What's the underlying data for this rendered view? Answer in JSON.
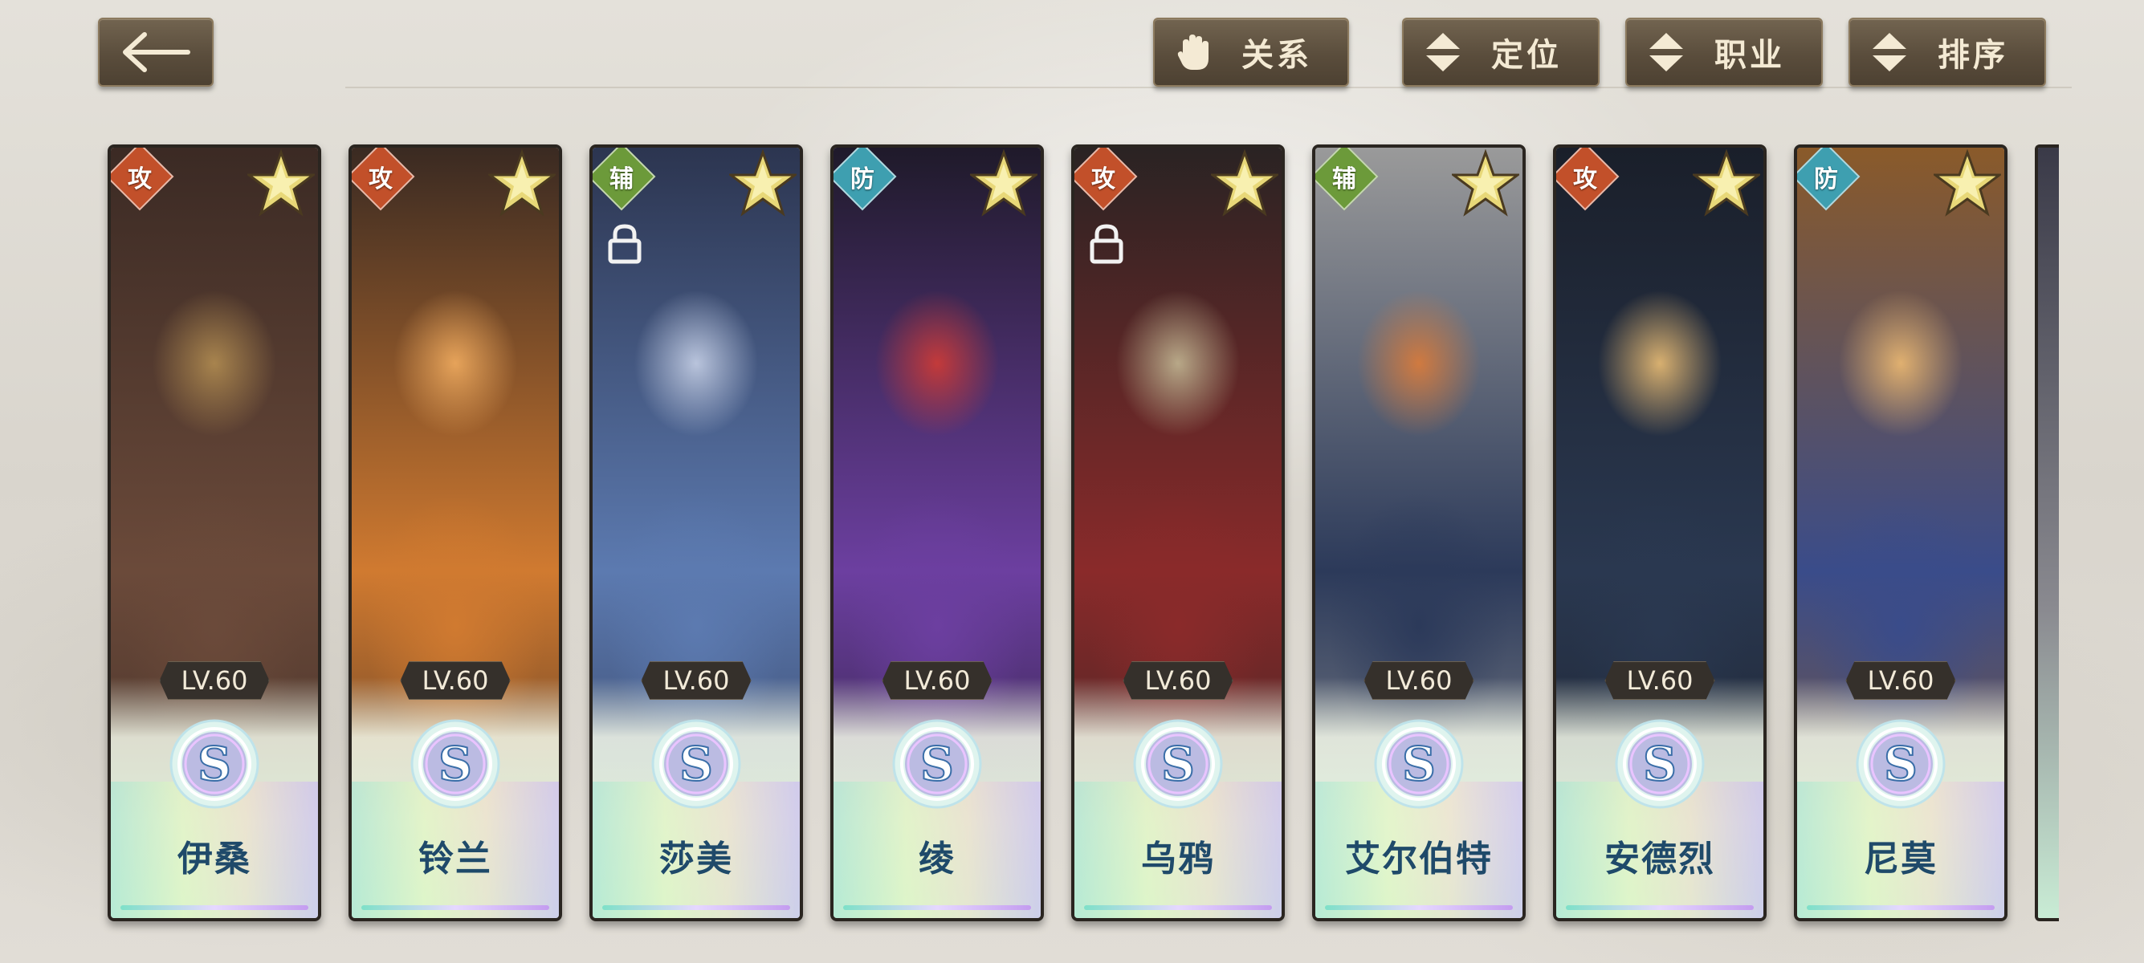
{
  "toolbar": {
    "back_label": "",
    "relation_label": "关系",
    "position_label": "定位",
    "job_label": "职业",
    "sort_label": "排序"
  },
  "colors": {
    "attack": "#c2502a",
    "support": "#6c9a3a",
    "defense": "#3e9fb0",
    "name_text": "#1f4a6a"
  },
  "cards": [
    {
      "role": "攻",
      "role_type": "attack",
      "level": "LV.60",
      "rank": "S",
      "name": "伊桑",
      "lock": false,
      "palette": [
        "#6b4a3a",
        "#3b2a24",
        "#a8844e"
      ]
    },
    {
      "role": "攻",
      "role_type": "attack",
      "level": "LV.60",
      "rank": "S",
      "name": "铃兰",
      "lock": false,
      "palette": [
        "#d07a30",
        "#3a2a22",
        "#e6a35a"
      ]
    },
    {
      "role": "辅",
      "role_type": "support",
      "level": "LV.60",
      "rank": "S",
      "name": "莎美",
      "lock": true,
      "palette": [
        "#5c7ab0",
        "#2c3550",
        "#b9c4dc"
      ]
    },
    {
      "role": "防",
      "role_type": "defense",
      "level": "LV.60",
      "rank": "S",
      "name": "绫",
      "lock": false,
      "palette": [
        "#6c3fa0",
        "#1f1a2a",
        "#c33a3a"
      ]
    },
    {
      "role": "攻",
      "role_type": "attack",
      "level": "LV.60",
      "rank": "S",
      "name": "乌鸦",
      "lock": true,
      "palette": [
        "#8a2a2a",
        "#2a2323",
        "#b8a888"
      ]
    },
    {
      "role": "辅",
      "role_type": "support",
      "level": "LV.60",
      "rank": "S",
      "name": "艾尔伯特",
      "lock": false,
      "palette": [
        "#2c3a5a",
        "#9a9a9a",
        "#d07a40"
      ]
    },
    {
      "role": "攻",
      "role_type": "attack",
      "level": "LV.60",
      "rank": "S",
      "name": "安德烈",
      "lock": false,
      "palette": [
        "#2a3850",
        "#1a1f2a",
        "#d8b070"
      ]
    },
    {
      "role": "防",
      "role_type": "defense",
      "level": "LV.60",
      "rank": "S",
      "name": "尼莫",
      "lock": false,
      "palette": [
        "#3a4c8a",
        "#8a5a2a",
        "#e0b070"
      ]
    }
  ],
  "icons": {
    "back": "left-arrow-icon",
    "relation": "hand-icon",
    "sort": "up-down-arrows-icon",
    "star": "star-icon",
    "lock": "lock-icon"
  }
}
